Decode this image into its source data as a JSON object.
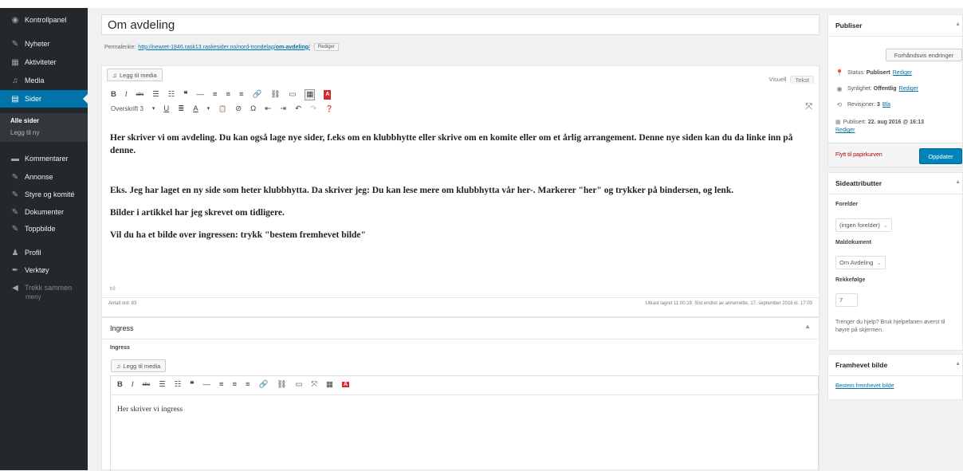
{
  "sidebar": {
    "items": [
      {
        "label": "Kontrollpanel",
        "icon": "dashboard-icon",
        "glyph": "◉"
      },
      {
        "label": "Nyheter",
        "icon": "pin-icon",
        "glyph": "✎"
      },
      {
        "label": "Aktiviteter",
        "icon": "calendar-icon",
        "glyph": "▦"
      },
      {
        "label": "Media",
        "icon": "media-icon",
        "glyph": "♫"
      },
      {
        "label": "Sider",
        "icon": "pages-icon",
        "glyph": "▤"
      },
      {
        "label": "Kommentarer",
        "icon": "comment-icon",
        "glyph": "▬"
      },
      {
        "label": "Annonse",
        "icon": "pin-icon",
        "glyph": "✎"
      },
      {
        "label": "Styre og komité",
        "icon": "pin-icon",
        "glyph": "✎"
      },
      {
        "label": "Dokumenter",
        "icon": "pin-icon",
        "glyph": "✎"
      },
      {
        "label": "Toppbilde",
        "icon": "pin-icon",
        "glyph": "✎"
      },
      {
        "label": "Profil",
        "icon": "user-icon",
        "glyph": "♟"
      },
      {
        "label": "Verktøy",
        "icon": "wrench-icon",
        "glyph": "✒"
      },
      {
        "label": "Trekk sammen",
        "icon": "collapse-icon",
        "glyph": "◀"
      }
    ],
    "collapse_line2": "meny",
    "submenu": {
      "current": "Alle sider",
      "other": "Legg til ny"
    }
  },
  "editor": {
    "title": "Om avdeling",
    "permalink_label": "Permalenke:",
    "permalink_base": "http://newret-1846.rask13.raskesider.no/nord-trondelag/",
    "permalink_slug": "om-avdeling",
    "permalink_end": "/",
    "edit_label": "Rediger",
    "add_media": "Legg til media",
    "tab_visual": "Visuell",
    "tab_text": "Tekst",
    "format_select": "Overskrift 3",
    "toolbar1": [
      "B",
      "I",
      "abc",
      "☰",
      "☷",
      "❝",
      "—",
      "≡",
      "≡",
      "≡",
      "🔗",
      "⛓",
      "▭"
    ],
    "toolbar2": [
      "U",
      "≣",
      "A",
      "▾",
      "📋",
      "⊘",
      "Ω",
      "⇤",
      "⇥",
      "↶",
      "↷",
      "❓"
    ],
    "paragraphs": [
      "Her skriver vi om avdeling. Du kan også lage nye sider, f.eks om en klubbhytte eller skrive om en komite eller om et årlig arrangement. Denne nye siden kan du da linke inn på denne.",
      "Eks. Jeg har laget en ny side som heter klubbhytta. Da skriver jeg: Du kan lese mere om klubbhytta vår her-. Markerer \"her\" og trykker på bindersen, og lenk.",
      "Bilder i artikkel har jeg skrevet om tidligere.",
      "Vil du ha et bilde over ingressen: trykk \"bestem fremhevet bilde\""
    ],
    "path": "h3",
    "word_count": "Antall ord: 83",
    "autosave": "Utkast lagret 11:00:19. Sist endret av annemette, 17. september 2016 kl. 17:03"
  },
  "ingress": {
    "box_title": "Ingress",
    "label": "Ingress",
    "add_media": "Legg til media",
    "text": "Her skriver vi ingress"
  },
  "publish": {
    "title": "Publiser",
    "preview": "Forhåndsvis endringer",
    "status_label": "Status:",
    "status_value": "Publisert",
    "visibility_label": "Synlighet:",
    "visibility_value": "Offentlig",
    "revisions_label": "Revisjoner:",
    "revisions_value": "3",
    "revisions_link": "Bla",
    "published_label": "Publisert:",
    "published_value": "22. aug 2016 @ 16:13",
    "edit": "Rediger",
    "trash": "Flytt til papirkurven",
    "update": "Oppdater"
  },
  "attributes": {
    "title": "Sideattributter",
    "parent_label": "Forelder",
    "parent_value": "(ingen forelder)",
    "template_label": "Maldokument",
    "template_value": "Om Avdeling",
    "order_label": "Rekkefølge",
    "order_value": "7",
    "help": "Trenger du hjelp? Bruk hjelpefanen øverst til høyre på skjermen."
  },
  "featured": {
    "title": "Framhevet bilde",
    "link": "Bestem fremhevet bilde"
  },
  "colors": {
    "sidebar": "#23282d",
    "accent": "#0073aa",
    "button": "#0085ba",
    "danger": "#a00"
  }
}
